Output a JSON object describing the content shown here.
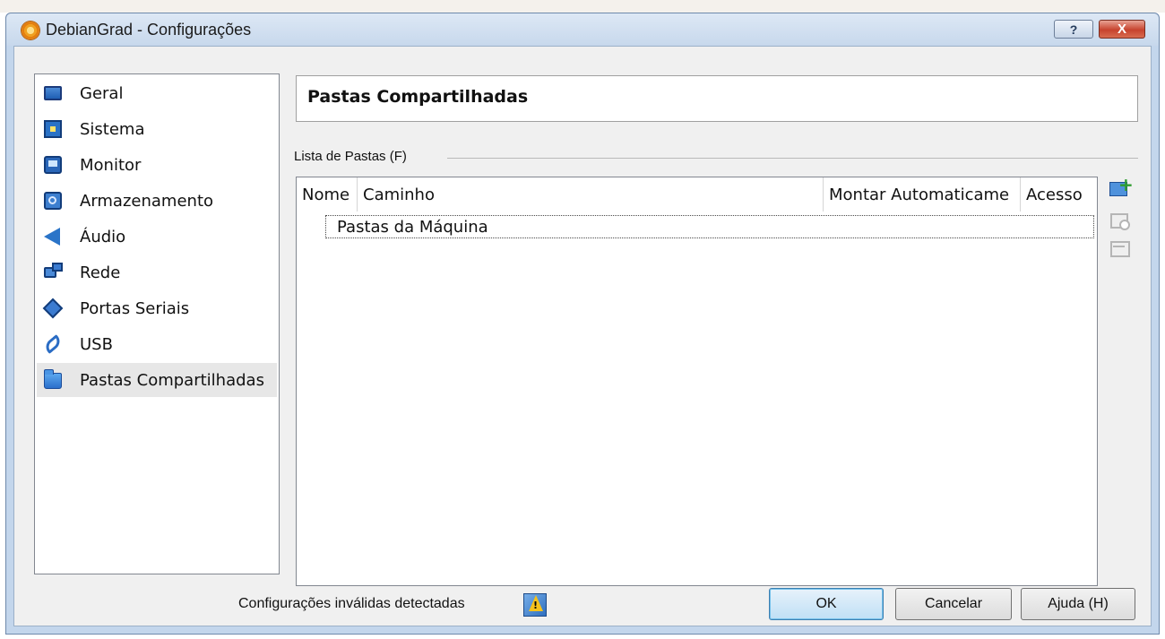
{
  "window": {
    "title": "DebianGrad - Configurações",
    "help_button": "?",
    "close_button": "X"
  },
  "sidebar": {
    "items": [
      {
        "label": "Geral",
        "icon": "monitor-icon"
      },
      {
        "label": "Sistema",
        "icon": "chip-icon"
      },
      {
        "label": "Monitor",
        "icon": "display-icon"
      },
      {
        "label": "Armazenamento",
        "icon": "storage-icon"
      },
      {
        "label": "Áudio",
        "icon": "speaker-icon"
      },
      {
        "label": "Rede",
        "icon": "network-icon"
      },
      {
        "label": "Portas Seriais",
        "icon": "serial-port-icon"
      },
      {
        "label": "USB",
        "icon": "usb-icon"
      },
      {
        "label": "Pastas Compartilhadas",
        "icon": "folder-icon",
        "selected": true
      }
    ]
  },
  "page": {
    "title": "Pastas Compartilhadas",
    "group_label": "Lista de Pastas (F)"
  },
  "table": {
    "columns": [
      "Nome",
      "Caminho",
      "Montar Automaticame",
      "Acesso"
    ],
    "rows": [
      {
        "label": "Pastas da Máquina"
      }
    ]
  },
  "toolbar": {
    "buttons": [
      {
        "icon": "add-folder-icon",
        "enabled": true
      },
      {
        "icon": "edit-folder-icon",
        "enabled": false
      },
      {
        "icon": "remove-folder-icon",
        "enabled": false
      }
    ]
  },
  "footer": {
    "status": "Configurações inválidas detectadas",
    "status_icon": "warning-icon",
    "ok_label": "OK",
    "cancel_label": "Cancelar",
    "help_label": "Ajuda (H)"
  }
}
